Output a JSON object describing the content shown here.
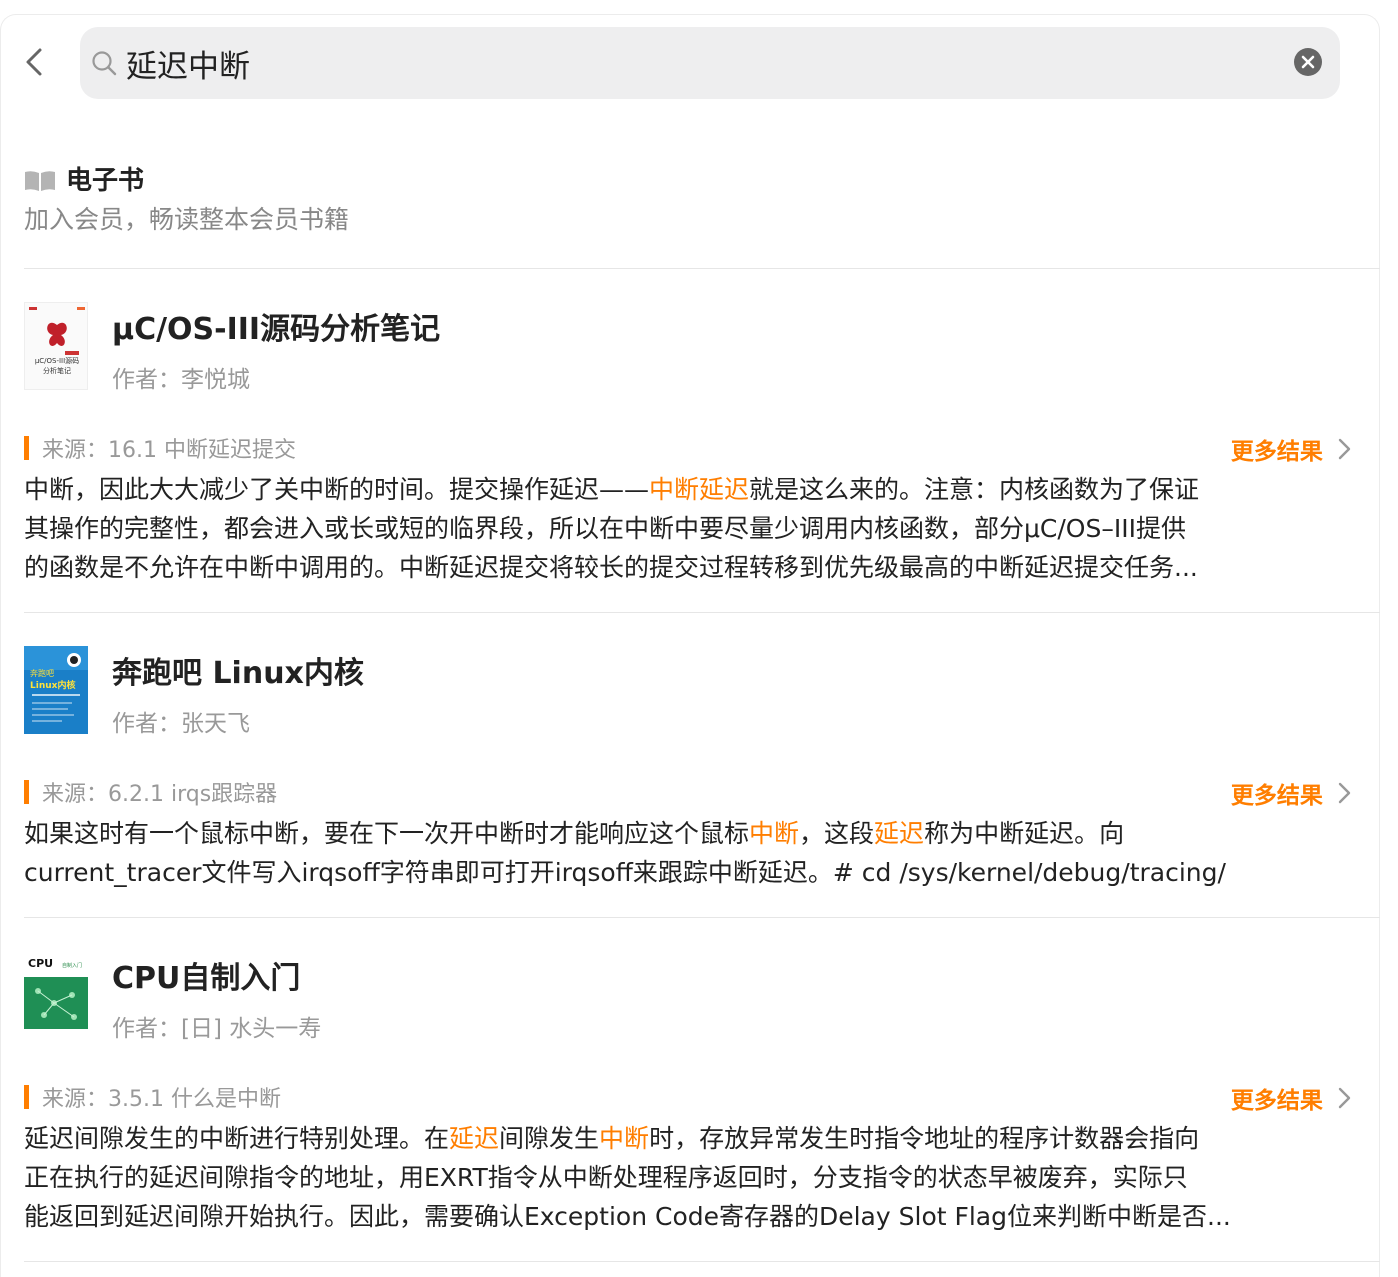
{
  "search": {
    "query": "延迟中断"
  },
  "section": {
    "title": "电子书",
    "subtitle": "加入会员，畅读整本会员书籍"
  },
  "results": [
    {
      "title": "μC/OS-III源码分析笔记",
      "author": "作者：李悦城",
      "source": "来源：16.1 中断延迟提交",
      "more": "更多结果",
      "cover_text": [
        "μC/OS-III源码",
        "分析笔记"
      ],
      "excerpt": [
        [
          "中断，因此大大减少了关中断的时间。提交操作延迟——",
          "中断延迟",
          "就是这么来的。注意：内核函数为了保证"
        ],
        [
          "其操作的完整性，都会进入或长或短的临界段，所以在中断中要尽量少调用内核函数，部分μC/OS–III提供"
        ],
        [
          "的函数是不允许在中断中调用的。中断延迟提交将较长的提交过程转移到优先级最高的中断延迟提交任务..."
        ]
      ]
    },
    {
      "title": "奔跑吧 Linux内核",
      "author": "作者：张天飞",
      "source": "来源：6.2.1 irqs跟踪器",
      "more": "更多结果",
      "cover_text": [
        "奔跑吧",
        "Linux内核"
      ],
      "excerpt": [
        [
          "如果这时有一个鼠标中断，要在下一次开中断时才能响应这个鼠标",
          "中断",
          "，这段",
          "延迟",
          "称为中断延迟。向"
        ],
        [
          "current_tracer文件写入irqsoff字符串即可打开irqsoff来跟踪中断延迟。# cd /sys/kernel/debug/tracing/"
        ]
      ]
    },
    {
      "title": "CPU自制入门",
      "author": "作者：[日] 水头一寿",
      "source": "来源：3.5.1 什么是中断",
      "more": "更多结果",
      "cover_text": [
        "CPU",
        "自制入门"
      ],
      "excerpt": [
        [
          "延迟间隙发生的中断进行特别处理。在",
          "延迟",
          "间隙发生",
          "中断",
          "时，存放异常发生时指令地址的程序计数器会指向"
        ],
        [
          "正在执行的延迟间隙指令的地址，用EXRT指令从中断处理程序返回时，分支指令的状态早被废弃，实际只"
        ],
        [
          "能返回到延迟间隙开始执行。因此，需要确认Exception Code寄存器的Delay Slot Flag位来判断中断是否..."
        ]
      ]
    }
  ],
  "colors": {
    "accent": "#ff7e00",
    "muted": "#999999",
    "search_bg": "#eeeeef"
  }
}
